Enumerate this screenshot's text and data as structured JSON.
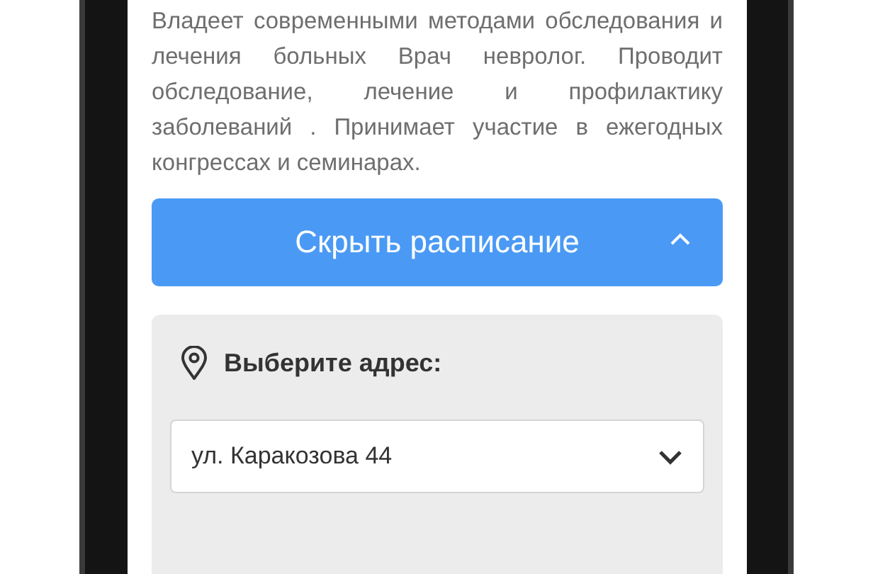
{
  "about": {
    "text": "Владеет современными методами обследования и лечения больных Врач невролог. Проводит обследование, лечение и профилактику заболеваний . Принимает участие в ежегодных конгрессах и семинарах."
  },
  "schedule_button": {
    "label": "Скрыть расписание",
    "expanded": true
  },
  "address": {
    "label": "Выберите адрес:",
    "value": "ул. Каракозова 44"
  }
}
